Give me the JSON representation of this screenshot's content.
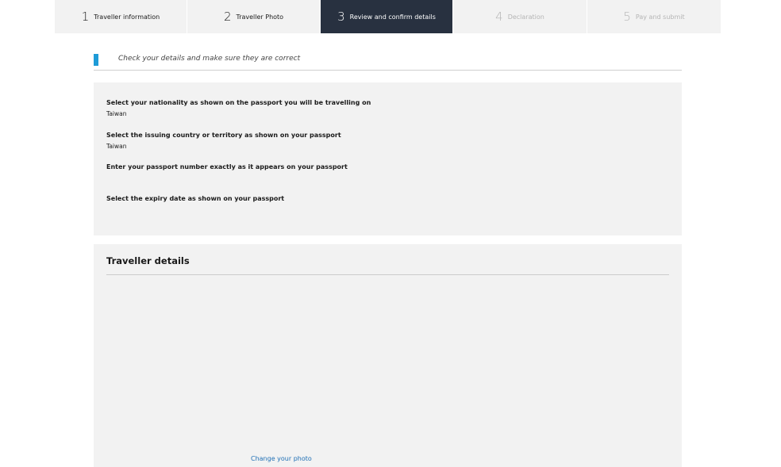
{
  "steps": [
    {
      "num": "1",
      "label": "Traveller information"
    },
    {
      "num": "2",
      "label": "Traveller Photo"
    },
    {
      "num": "3",
      "label": "Review and confirm details"
    },
    {
      "num": "4",
      "label": "Declaration"
    },
    {
      "num": "5",
      "label": "Pay and submit"
    }
  ],
  "subheading": "Check your details and make sure they are correct",
  "passport": {
    "nationality_q": "Select your nationality as shown on the passport you will be travelling on",
    "nationality_a": "Taiwan",
    "issuing_q": "Select the issuing country or territory as shown on your passport",
    "issuing_a": "Taiwan",
    "number_q": "Enter your passport number exactly as it appears on your passport",
    "expiry_q": "Select the expiry date as shown on your passport"
  },
  "traveller": {
    "title": "Traveller details",
    "change_photo": "Change your photo"
  },
  "colors": {
    "active_step": "#283140",
    "accent": "#1e9bd7",
    "link": "#1f6fb5",
    "panel": "#f2f2f2"
  }
}
